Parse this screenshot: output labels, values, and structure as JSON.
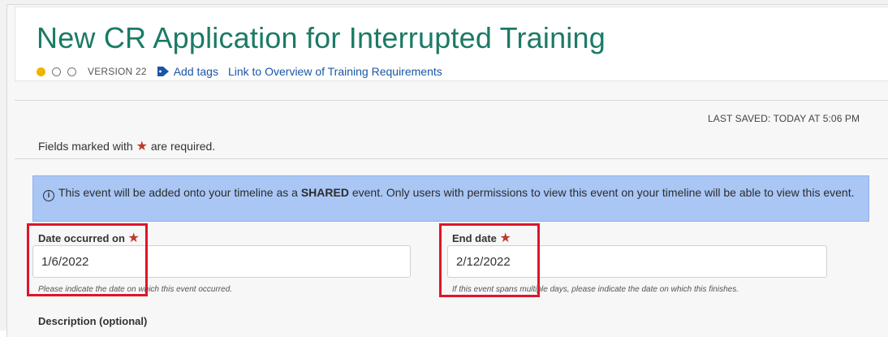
{
  "page": {
    "title": "New CR Application for Interrupted Training",
    "status_dots": [
      "filled",
      "empty",
      "empty"
    ],
    "version_label": "VERSION 22",
    "tag_icon": "tag-icon",
    "add_tags_label": "Add tags",
    "overview_link_label": "Link to Overview of Training Requirements"
  },
  "form": {
    "required_note_prefix": "Fields marked with",
    "required_star": "★",
    "required_note_suffix": "are required.",
    "last_saved": "LAST SAVED: TODAY AT 5:06 PM",
    "info_banner": {
      "icon": "info-icon",
      "text_before": "This event will be added onto your timeline as a",
      "bold": "SHARED",
      "text_after": "event. Only users with permissions to view this event on your timeline will be able to view this event."
    },
    "date_occurred": {
      "label": "Date occurred on",
      "value": "1/6/2022",
      "help": "Please indicate the date on which this event occurred."
    },
    "end_date": {
      "label": "End date",
      "value": "2/12/2022",
      "help": "If this event spans multiple days, please indicate the date on which this finishes."
    },
    "description_label": "Description (optional)"
  },
  "colors": {
    "title": "#1b7a66",
    "link": "#1a56a6",
    "status_filled": "#f0b400",
    "banner_bg": "#a9c6f5",
    "required_star": "#c0392b",
    "annotation_box": "#e0142a"
  }
}
